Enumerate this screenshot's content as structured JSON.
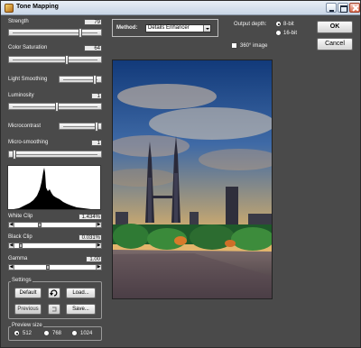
{
  "window": {
    "title": "Tone Mapping"
  },
  "sliders": [
    {
      "id": "strength",
      "label": "Strength",
      "value": "79",
      "fraction": 0.79
    },
    {
      "id": "color_saturation",
      "label": "Color Saturation",
      "value": "64",
      "fraction": 0.64
    },
    {
      "id": "light_smoothing",
      "label": "Light Smoothing",
      "value": "",
      "fraction": 0.9
    },
    {
      "id": "luminosity",
      "label": "Luminosity",
      "value": "1",
      "fraction": 0.52
    },
    {
      "id": "microcontrast",
      "label": "Microcontrast",
      "value": "",
      "fraction": 0.95
    },
    {
      "id": "micro_smoothing",
      "label": "Micro-smoothing",
      "value": "1",
      "fraction": 0.03
    }
  ],
  "clips": {
    "white_clip": {
      "label": "White Clip",
      "value": "1.434%",
      "fraction": 0.3
    },
    "black_clip": {
      "label": "Black Clip",
      "value": "0.031%",
      "fraction": 0.05
    },
    "gamma": {
      "label": "Gamma",
      "value": "1.00",
      "fraction": 0.4
    }
  },
  "settings": {
    "title": "Settings",
    "default_label": "Default",
    "load_label": "Load...",
    "previous_label": "Previous",
    "save_label": "Save..."
  },
  "preview_size": {
    "title": "Preview size",
    "options": [
      "512",
      "768",
      "1024"
    ],
    "selected": "512"
  },
  "method": {
    "label": "Method:",
    "value": "Details Enhancer"
  },
  "output_depth": {
    "label": "Output depth:",
    "options": [
      "8-bit",
      "16-bit"
    ],
    "selected": "8-bit"
  },
  "image360": {
    "label": "360° image",
    "checked": false
  },
  "buttons": {
    "ok": "OK",
    "cancel": "Cancel"
  },
  "icons": {
    "app": "app-icon",
    "reset": "reset-arrow-icon",
    "undo": "undo-icon"
  },
  "colors": {
    "panel_bg": "#4a4a4a",
    "titlebar": "#d6e0ec"
  }
}
